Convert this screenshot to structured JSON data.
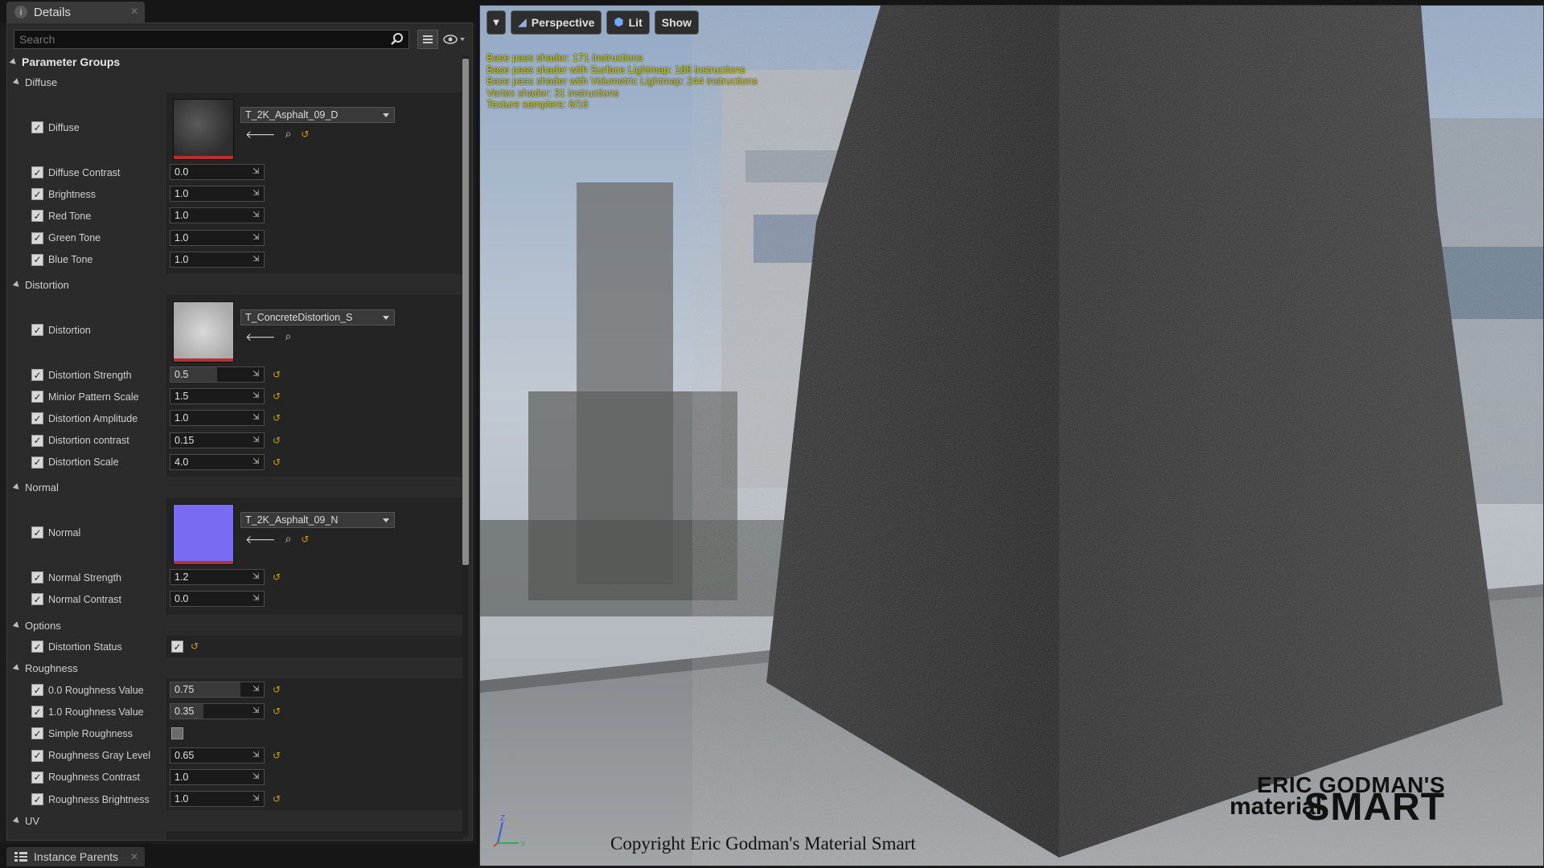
{
  "details_tab": {
    "label": "Details",
    "icon": "info-icon"
  },
  "search": {
    "placeholder": "Search"
  },
  "parameter_groups_label": "Parameter Groups",
  "groups": {
    "diffuse": {
      "label": "Diffuse",
      "texture": {
        "label": "Diffuse",
        "asset": "T_2K_Asphalt_09_D"
      },
      "params": [
        {
          "label": "Diffuse Contrast",
          "value": "0.0"
        },
        {
          "label": "Brightness",
          "value": "1.0"
        },
        {
          "label": "Red Tone",
          "value": "1.0"
        },
        {
          "label": "Green Tone",
          "value": "1.0"
        },
        {
          "label": "Blue Tone",
          "value": "1.0"
        }
      ]
    },
    "distortion": {
      "label": "Distortion",
      "texture": {
        "label": "Distortion",
        "asset": "T_ConcreteDistortion_S"
      },
      "params": [
        {
          "label": "Distortion Strength",
          "value": "0.5",
          "fill": 0.5
        },
        {
          "label": "Minior Pattern Scale",
          "value": "1.5"
        },
        {
          "label": "Distortion Amplitude",
          "value": "1.0"
        },
        {
          "label": "Distortion contrast",
          "value": "0.15"
        },
        {
          "label": "Distortion Scale",
          "value": "4.0"
        }
      ]
    },
    "normal": {
      "label": "Normal",
      "texture": {
        "label": "Normal",
        "asset": "T_2K_Asphalt_09_N"
      },
      "params": [
        {
          "label": "Normal Strength",
          "value": "1.2"
        },
        {
          "label": "Normal Contrast",
          "value": "0.0"
        }
      ]
    },
    "options": {
      "label": "Options",
      "params": [
        {
          "label": "Distortion Status",
          "checked": true
        }
      ]
    },
    "roughness": {
      "label": "Roughness",
      "params": [
        {
          "label": "0.0 Roughness Value",
          "value": "0.75",
          "fill": 0.75
        },
        {
          "label": "1.0 Roughness Value",
          "value": "0.35",
          "fill": 0.35
        },
        {
          "label": "Simple Roughness",
          "checked": false
        },
        {
          "label": "Roughness Gray Level",
          "value": "0.65"
        },
        {
          "label": "Roughness Contrast",
          "value": "1.0"
        },
        {
          "label": "Roughness Brightness",
          "value": "1.0"
        }
      ]
    },
    "uv": {
      "label": "UV"
    }
  },
  "bottom_tab": {
    "label": "Instance Parents"
  },
  "viewport": {
    "toolbar": {
      "perspective": "Perspective",
      "lit": "Lit",
      "show": "Show"
    },
    "stats": [
      "Base pass shader: 171 instructions",
      "Base pass shader with Surface Lightmap: 188 instructions",
      "Base pass shader with Volumetric Lightmap: 244 instructions",
      "Vertex shader: 31 instructions",
      "Texture samplers: 6/16"
    ],
    "axes": {
      "z": "Z",
      "y": "Y"
    },
    "copyright": "Copyright Eric Godman's Material Smart",
    "brand": {
      "line1": "ERIC GODMAN'S",
      "material": "material",
      "smart": "SMART"
    }
  },
  "colors": {
    "stats_text": "#c8c400",
    "reset_arrow": "#c8a300",
    "normal_map": "#7a6cf2",
    "texture_bar": "#b53030"
  }
}
